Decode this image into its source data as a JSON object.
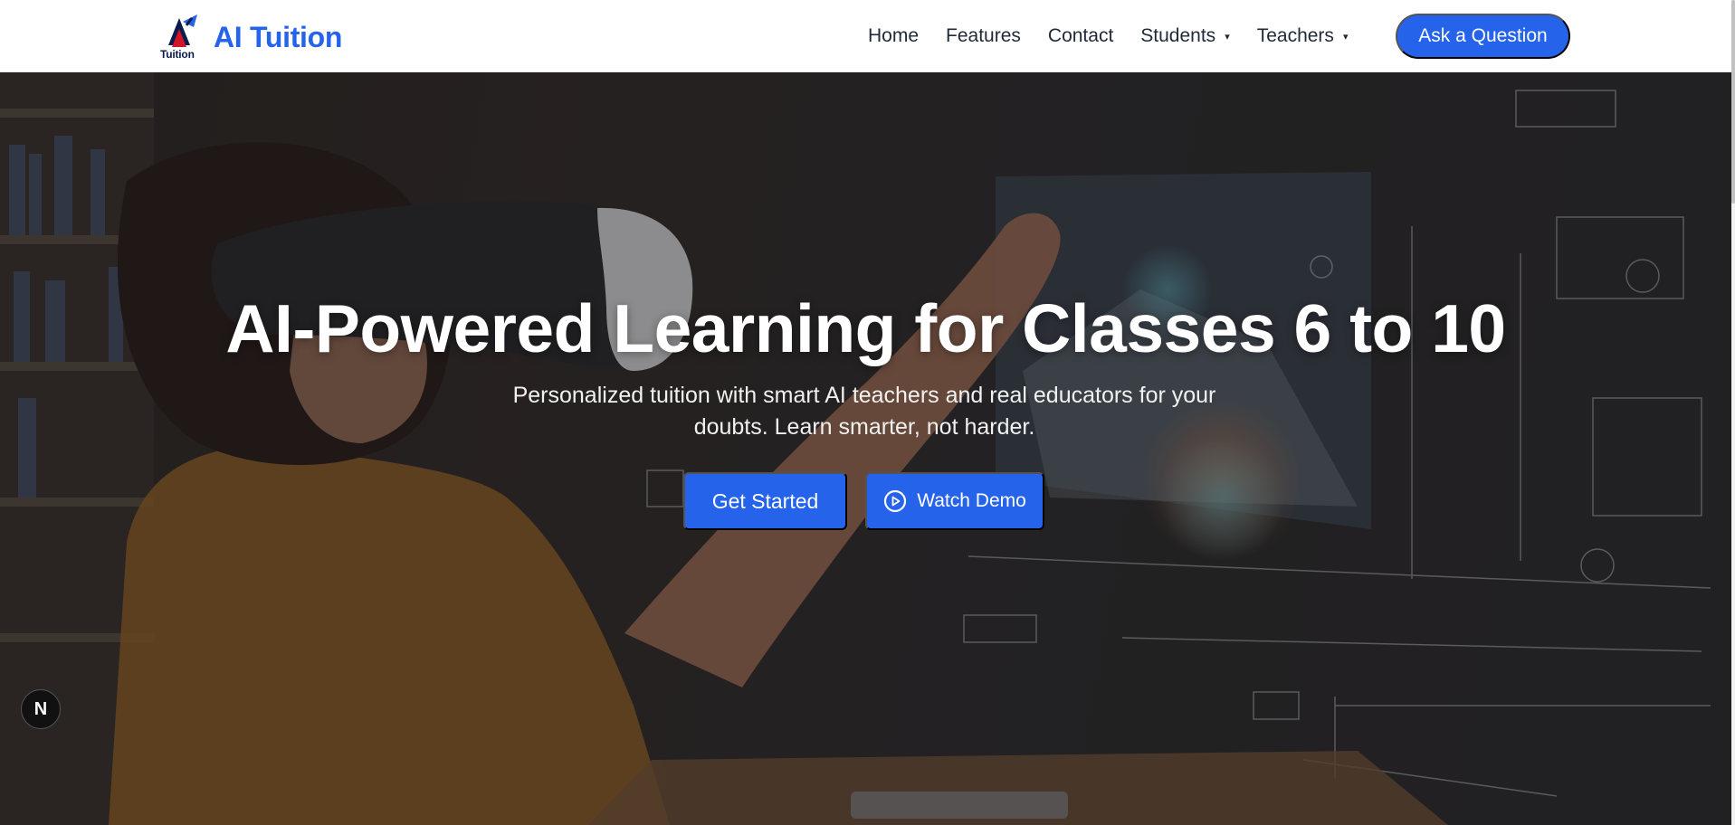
{
  "header": {
    "brand_name": "AI Tuition",
    "logo_text": "Tuition",
    "nav": [
      {
        "label": "Home"
      },
      {
        "label": "Features"
      },
      {
        "label": "Contact"
      },
      {
        "label": "Students",
        "dropdown": true
      },
      {
        "label": "Teachers",
        "dropdown": true
      }
    ],
    "cta_label": "Ask a Question",
    "caret_icon": "▾"
  },
  "hero": {
    "title": "AI-Powered Learning for Classes 6 to 10",
    "subtitle": "Personalized tuition with smart AI teachers and real educators for your doubts. Learn smarter, not harder.",
    "primary_button": "Get Started",
    "secondary_button": "Watch Demo",
    "background_image": "girl-vr-headset-holographic-screens"
  },
  "badge": {
    "label": "N"
  },
  "colors": {
    "brand_blue": "#2563eb",
    "nav_text": "#1f2937",
    "logo_red": "#d3132a",
    "logo_navy": "#0b1b4a"
  }
}
